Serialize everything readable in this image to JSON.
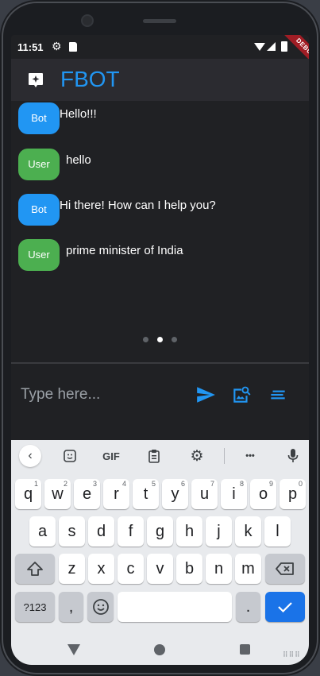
{
  "status_bar": {
    "time": "11:51",
    "debug_badge": "DEBUG"
  },
  "app_bar": {
    "title": "FBOT",
    "title_color": "#2196f3",
    "logo_icon": "chat-sparkle-icon"
  },
  "messages": [
    {
      "sender": "Bot",
      "text": "Hello!!!"
    },
    {
      "sender": "User",
      "text": "hello"
    },
    {
      "sender": "Bot",
      "text": "Hi there! How can I help you?"
    },
    {
      "sender": "User",
      "text": "prime minister of India"
    }
  ],
  "page_indicator": {
    "count": 3,
    "active_index": 1
  },
  "composer": {
    "placeholder": "Type here...",
    "value": "",
    "send_icon": "send-icon",
    "image_search_icon": "image-search-icon",
    "menu_icon": "short-text-icon"
  },
  "keyboard": {
    "toolbar": [
      "back-chevron-icon",
      "sticker-icon",
      "GIF",
      "clipboard-icon",
      "gear-icon",
      "more-icon",
      "mic-icon"
    ],
    "toolbar_gif_label": "GIF",
    "toolbar_more_label": "•••",
    "row1": [
      {
        "k": "q",
        "h": "1"
      },
      {
        "k": "w",
        "h": "2"
      },
      {
        "k": "e",
        "h": "3"
      },
      {
        "k": "r",
        "h": "4"
      },
      {
        "k": "t",
        "h": "5"
      },
      {
        "k": "y",
        "h": "6"
      },
      {
        "k": "u",
        "h": "7"
      },
      {
        "k": "i",
        "h": "8"
      },
      {
        "k": "o",
        "h": "9"
      },
      {
        "k": "p",
        "h": "0"
      }
    ],
    "row2": [
      "a",
      "s",
      "d",
      "f",
      "g",
      "h",
      "j",
      "k",
      "l"
    ],
    "row3": [
      "z",
      "x",
      "c",
      "v",
      "b",
      "n",
      "m"
    ],
    "symbols_label": "?123",
    "comma_label": ",",
    "period_label": ".",
    "shift_icon": "shift-icon",
    "backspace_icon": "backspace-icon",
    "emoji_icon": "emoji-icon",
    "enter_icon": "check-icon"
  },
  "nav_bar": {
    "back_icon": "nav-back-icon",
    "home_icon": "nav-home-icon",
    "recents_icon": "nav-recents-icon",
    "keyboard_switch_label": "⠿⠿⠿"
  },
  "colors": {
    "bot_bubble": "#2196f3",
    "user_bubble": "#4caf50",
    "background": "#202124",
    "appbar": "#2b2b30",
    "enter_key": "#1a73e8"
  }
}
